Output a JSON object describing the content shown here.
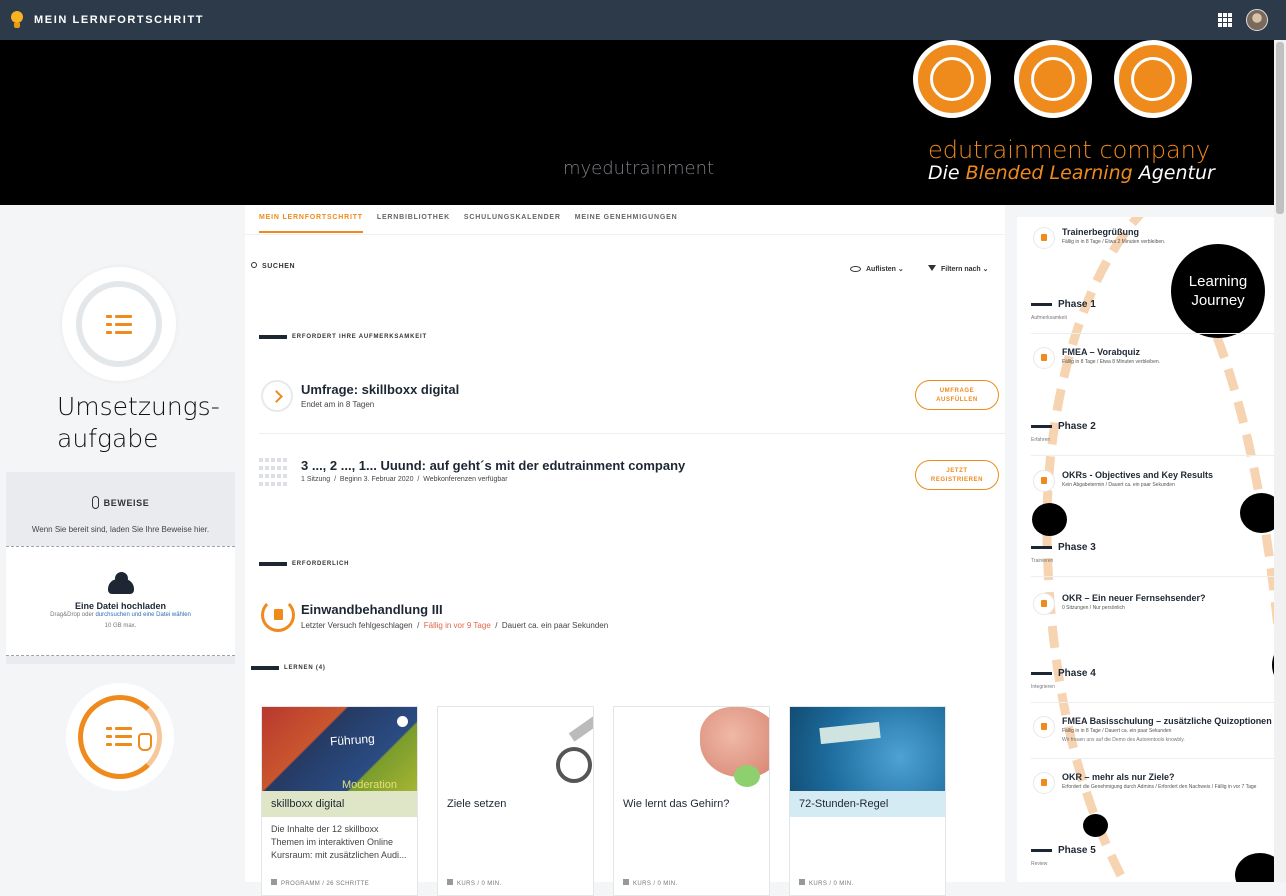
{
  "topbar": {
    "title": "MEIN LERNFORTSCHRITT",
    "icons": [
      "lightbulb-icon",
      "apps-grid-icon",
      "avatar"
    ]
  },
  "banner": {
    "site_name": "myedutrainment",
    "company": "edutrainment company",
    "tagline_pre": "Die ",
    "tagline_hl": "Blended Learning",
    "tagline_post": " Agentur"
  },
  "tabs": [
    {
      "label": "MEIN LERNFORTSCHRITT",
      "active": true
    },
    {
      "label": "LERNBIBLIOTHEK",
      "active": false
    },
    {
      "label": "SCHULUNGSKALENDER",
      "active": false
    },
    {
      "label": "MEINE GENEHMIGUNGEN",
      "active": false
    }
  ],
  "toolbar": {
    "search_label": "SUCHEN",
    "view_label": "Auflisten",
    "filter_label": "Filtern nach"
  },
  "left": {
    "task_title_1": "Umsetzungs-",
    "task_title_2": "aufgabe",
    "proof_label": "BEWEISE",
    "proof_hint": "Wenn Sie bereit sind, laden Sie Ihre Beweise hier.",
    "upload_title": "Eine Datei hochladen",
    "upload_sub_pre": "Drag&Drop oder ",
    "upload_sub_link": "durchsuchen und eine Datei wählen",
    "upload_size": "10 GB max."
  },
  "sections": {
    "attention": "ERFORDERT IHRE AUFMERKSAMKEIT",
    "required": "ERFORDERLICH",
    "learn": "LERNEN (4)"
  },
  "attention_items": [
    {
      "title": "Umfrage: skillboxx digital",
      "meta": "Endet am in 8 Tagen",
      "button": [
        "UMFRAGE",
        "AUSFÜLLEN"
      ]
    },
    {
      "title": "3 ..., 2 ..., 1... Uuund: auf geht´s mit der edutrainment company",
      "meta_1": "1 Sitzung",
      "meta_2": "Beginn 3. Februar 2020",
      "meta_3": "Webkonferenzen verfügbar",
      "button": [
        "JETZT",
        "REGISTRIEREN"
      ]
    }
  ],
  "required_item": {
    "title": "Einwandbehandlung III",
    "meta_1": "Letzter Versuch fehlgeschlagen",
    "meta_2": "Fällig in vor 9 Tage",
    "meta_3": "Dauert ca. ein paar Sekunden"
  },
  "cards": [
    {
      "title": "skillboxx digital",
      "desc": "Die Inhalte der 12 skillboxx Themen im interaktiven Online Kursraum: mit zusätzlichen Audi...",
      "foot": "PROGRAMM / 26 SCHRITTE",
      "img_text": "Führung",
      "img_text2": "Moderation"
    },
    {
      "title": "Ziele setzen",
      "desc": "",
      "foot": "KURS / 0 MIN."
    },
    {
      "title": "Wie lernt das Gehirn?",
      "desc": "",
      "foot": "KURS / 0 MIN."
    },
    {
      "title": "72-Stunden-Regel",
      "desc": "",
      "foot": "KURS / 0 MIN."
    }
  ],
  "journey": {
    "badge_1": "Learning",
    "badge_2": "Journey",
    "items": [
      {
        "title": "Trainerbegrüßung",
        "meta": "Fällig in in 8 Tage  /  Etwa 2 Minuten verbleiben."
      },
      {
        "title": "FMEA – Vorabquiz",
        "meta": "Fällig in 8 Tage  /  Etwa 8 Minuten verbleiben."
      },
      {
        "title": "OKRs - Objectives and Key Results",
        "meta": "Kein Abgabetermin  /  Dauert ca. ein paar Sekunden"
      },
      {
        "title": "OKR – Ein neuer Fernsehsender?",
        "meta": "0 Sitzungen  /  Nur persönlich"
      },
      {
        "title": "FMEA Basisschulung – zusätzliche Quizoptionen",
        "meta": "Fällig in in 8 Tage  /  Dauert ca. ein paar Sekunden",
        "extra": "Wir freuen uns auf die Demo des Autorentools knowbly."
      },
      {
        "title": "OKR – mehr als nur Ziele?",
        "meta": "Erfordert die Genehmigung durch Admins  /  Erfordert den Nachweis  /  Fällig in vor 7 Tage"
      }
    ],
    "phases": [
      {
        "label": "Phase 1",
        "sub": "Aufmerksamkeit"
      },
      {
        "label": "Phase 2",
        "sub": "Erfahren"
      },
      {
        "label": "Phase 3",
        "sub": "Trainieren"
      },
      {
        "label": "Phase 4",
        "sub": "Integrieren"
      },
      {
        "label": "Phase 5",
        "sub": "Review"
      }
    ]
  },
  "colors": {
    "accent": "#ef8a1c",
    "navy": "#2d3a4a",
    "dark": "#1d2733",
    "warning": "#e0664d"
  }
}
